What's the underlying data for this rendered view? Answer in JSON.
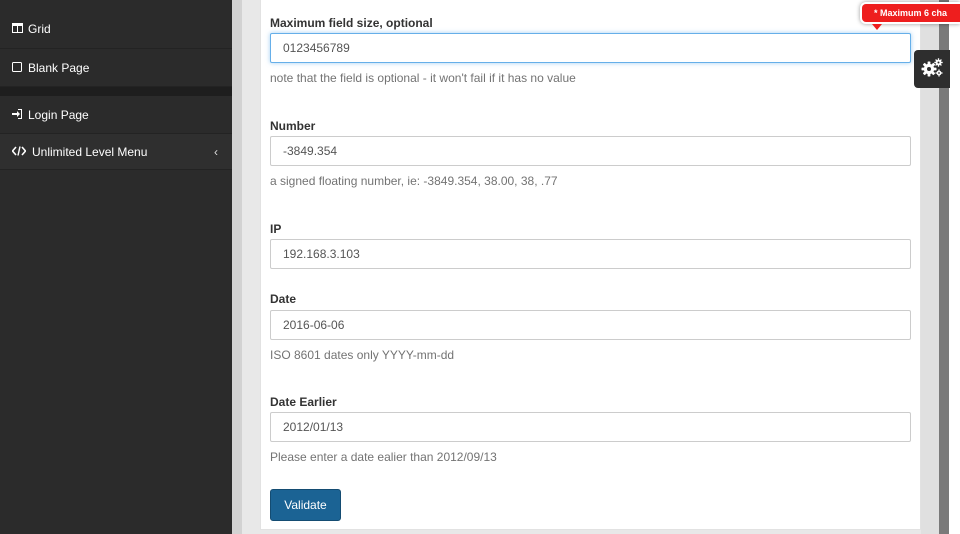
{
  "sidebar": {
    "items": [
      {
        "label": "Grid",
        "icon": "columns-icon"
      },
      {
        "label": "Blank Page",
        "icon": "square-icon"
      },
      {
        "label": "Login Page",
        "icon": "sign-in-icon"
      },
      {
        "label": "Unlimited Level Menu",
        "icon": "code-icon",
        "chevron": "‹"
      }
    ]
  },
  "form": {
    "max_field": {
      "label": "Maximum field size, optional",
      "value": "0123456789",
      "help": "note that the field is optional - it won't fail if it has no value"
    },
    "number": {
      "label": "Number",
      "value": "-3849.354",
      "help": "a signed floating number, ie: -3849.354, 38.00, 38, .77"
    },
    "ip": {
      "label": "IP",
      "value": "192.168.3.103"
    },
    "date": {
      "label": "Date",
      "value": "2016-06-06",
      "help": "ISO 8601 dates only YYYY-mm-dd"
    },
    "date_earlier": {
      "label": "Date Earlier",
      "value": "2012/01/13",
      "help": "Please enter a date ealier than 2012/09/13"
    },
    "validate_label": "Validate"
  },
  "tooltip": {
    "text": "* Maximum 6 cha"
  },
  "colors": {
    "sidebar_bg": "#2b2b2b",
    "button_bg": "#1b6394",
    "tooltip_bg": "#ee1e1e",
    "focus_border": "#66afe9"
  }
}
